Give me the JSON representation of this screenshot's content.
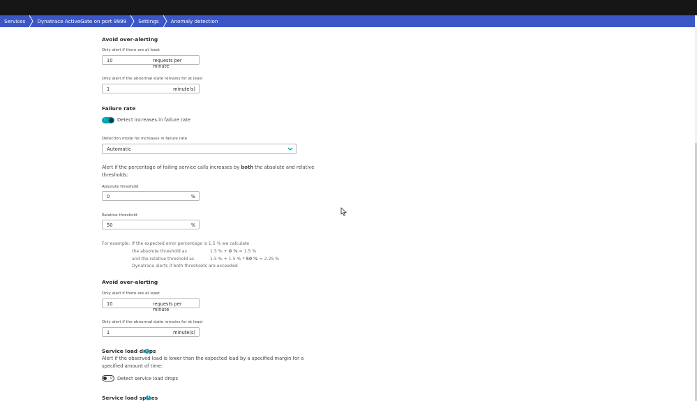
{
  "breadcrumb": [
    "Services",
    "Dynatrace ActiveGate on port 9999",
    "Settings",
    "Anomaly detection"
  ],
  "avoid1": {
    "heading": "Avoid over-alerting",
    "min_requests_label": "Only alert if there are at least",
    "min_requests_value": "10",
    "min_requests_unit": "requests per minute",
    "duration_label": "Only alert if the abnormal state remains for at least",
    "duration_value": "1",
    "duration_unit": "minute(s)"
  },
  "failure": {
    "heading": "Failure rate",
    "toggle_label": "Detect increases in failure rate",
    "toggle_on": true,
    "mode_label": "Detection mode for increases in failure rate",
    "mode_value": "Automatic",
    "desc_pre": "Alert if the percentage of failing service calls increases by ",
    "desc_bold": "both",
    "desc_post": " the absolute and relative",
    "desc_line2": "thresholds:",
    "abs_label": "Absolute threshold",
    "abs_value": "0",
    "abs_unit": "%",
    "rel_label": "Relative threshold",
    "rel_value": "50",
    "rel_unit": "%"
  },
  "example": {
    "prefix": "For example:",
    "line1": "If the expected error percentage is 1.5 % we calculate",
    "line2a": "the absolute threshold as",
    "line2b_pre": "1.5 % + ",
    "line2b_bold": "0 %",
    "line2b_post": " = 1.5 %",
    "line3a": "and the relative threshold as",
    "line3b_pre": "1.5 % + 1.5 % * ",
    "line3b_bold": "50 %",
    "line3b_post": " = 2.25 %",
    "line4": "Dynatrace alerts if both thresholds are exceeded"
  },
  "avoid2": {
    "heading": "Avoid over-alerting",
    "min_requests_label": "Only alert if there are at least",
    "min_requests_value": "10",
    "min_requests_unit": "requests per minute",
    "duration_label": "Only alert if the abnormal state remains for at least",
    "duration_value": "1",
    "duration_unit": "minute(s)"
  },
  "load_drops": {
    "heading": "Service load drops",
    "desc_line1": "Alert if the observed load is lower than the expected load by a specified margin for a",
    "desc_line2": "specified amount of time:",
    "toggle_label": "Detect service load drops",
    "toggle_on": false
  },
  "load_spikes": {
    "heading": "Service load spikes"
  },
  "colors": {
    "breadcrumb_bg": "#3b57c7",
    "toggle_on": "#00a1b2",
    "info_icon": "#1496b8",
    "topbar": "#161616"
  }
}
